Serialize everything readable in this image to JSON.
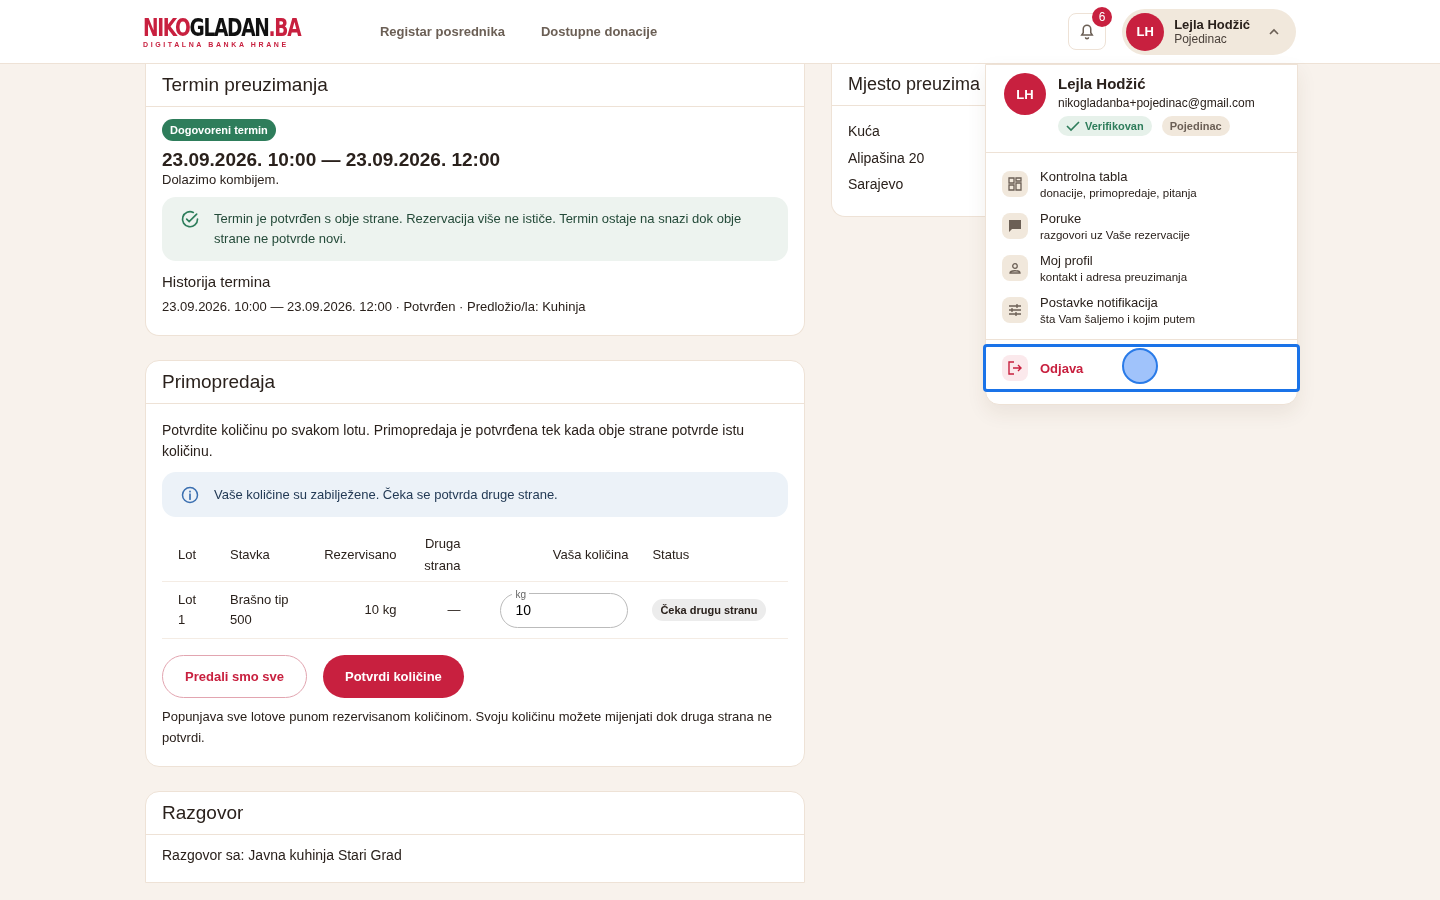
{
  "header": {
    "logo": {
      "parts": [
        {
          "text": "NIKO",
          "color": "#c8203f"
        },
        {
          "text": "GLADAN",
          "color": "#111111"
        },
        {
          "text": ".BA",
          "color": "#c8203f"
        }
      ],
      "tagline": "DIGITALNA BANKA HRANE"
    },
    "nav": [
      {
        "label": "Registar posrednika"
      },
      {
        "label": "Dostupne donacije"
      }
    ],
    "notifications": {
      "count": "6"
    },
    "user": {
      "initials": "LH",
      "name": "Lejla Hodžić",
      "role": "Pojedinac",
      "expanded": true
    }
  },
  "user_menu": {
    "initials": "LH",
    "name": "Lejla Hodžić",
    "email": "nikogladanba+pojedinac@gmail.com",
    "badges": [
      {
        "label": "Verifikovan",
        "kind": "verified"
      },
      {
        "label": "Pojedinac",
        "kind": "role"
      }
    ],
    "items": [
      {
        "title": "Kontrolna tabla",
        "subtitle": "donacije, primopredaje, pitanja"
      },
      {
        "title": "Poruke",
        "subtitle": "razgovori uz Vaše rezervacije"
      },
      {
        "title": "Moj profil",
        "subtitle": "kontakt i adresa preuzimanja"
      },
      {
        "title": "Postavke notifikacija",
        "subtitle": "šta Vam šaljemo i kojim putem"
      }
    ],
    "logout": {
      "label": "Odjava",
      "focused": true
    }
  },
  "term_card": {
    "title": "Termin preuzimanja",
    "badge": "Dogovoreni termin",
    "range": "23.09.2026. 10:00 — 23.09.2026. 12:00",
    "note": "Dolazimo kombijem.",
    "alert": "Termin je potvrđen s obje strane. Rezervacija više ne ističe. Termin ostaje na snazi dok obje strane ne potvrde novi.",
    "history_title": "Historija termina",
    "history": [
      "23.09.2026. 10:00 — 23.09.2026. 12:00 · Potvrđen · Predložio/la: Kuhinja"
    ]
  },
  "pickup_card": {
    "title": "Mjesto preuzima",
    "lines": [
      "Kuća",
      "Alipašina 20",
      "Sarajevo"
    ]
  },
  "handover_card": {
    "title": "Primopredaja",
    "intro": "Potvrdite količinu po svakom lotu. Primopredaja je potvrđena tek kada obje strane potvrde istu količinu.",
    "info": "Vaše količine su zabilježene. Čeka se potvrda druge strane.",
    "columns": [
      "Lot",
      "Stavka",
      "Rezervisano",
      "Druga strana",
      "Vaša količina",
      "Status"
    ],
    "rows": [
      {
        "lot": "Lot 1",
        "item": "Brašno tip 500",
        "reserved": "10 kg",
        "other": "—",
        "unit": "kg",
        "value": "10",
        "status": "Čeka drugu stranu"
      }
    ],
    "buttons": [
      {
        "label": "Predali smo sve",
        "kind": "outline"
      },
      {
        "label": "Potvrdi količine",
        "kind": "primary"
      }
    ],
    "footnote": "Popunjava sve lotove punom rezervisanom količinom. Svoju količinu možete mijenjati dok druga strana ne potvrdi."
  },
  "conversation_card": {
    "title": "Razgovor",
    "line": "Razgovor sa: Javna kuhinja Stari Grad"
  }
}
